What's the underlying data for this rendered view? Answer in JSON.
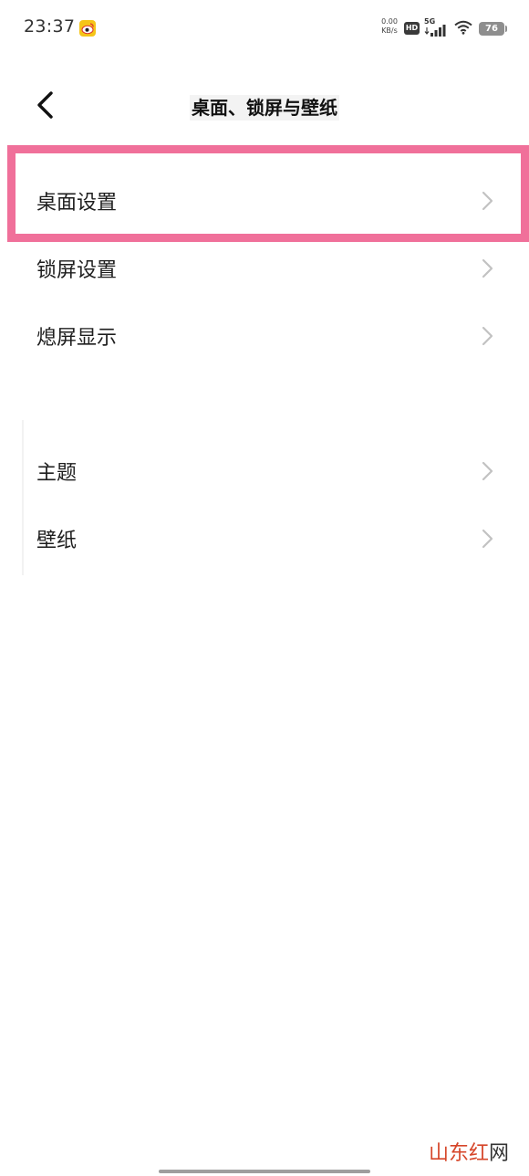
{
  "status_bar": {
    "time": "23:37",
    "net_speed_value": "0.00",
    "net_speed_unit": "KB/s",
    "hd_label": "HD",
    "network_label": "5G",
    "battery_level": "76",
    "icons": [
      "weibo-icon",
      "hd-icon",
      "signal-icon",
      "wifi-icon",
      "battery-icon"
    ]
  },
  "header": {
    "title": "桌面、锁屏与壁纸",
    "back_icon": "chevron-left-icon"
  },
  "settings": {
    "items": [
      {
        "label": "桌面设置",
        "highlighted": true
      },
      {
        "label": "锁屏设置"
      },
      {
        "label": "熄屏显示"
      },
      {
        "label": "主题"
      },
      {
        "label": "壁纸"
      }
    ],
    "item_icon": "chevron-right-icon"
  },
  "watermark": {
    "part1": "山东红",
    "part2": "网"
  },
  "colors": {
    "highlight": "#f0709a",
    "chevron": "#c2c2c2",
    "watermark": "#d6462a"
  }
}
